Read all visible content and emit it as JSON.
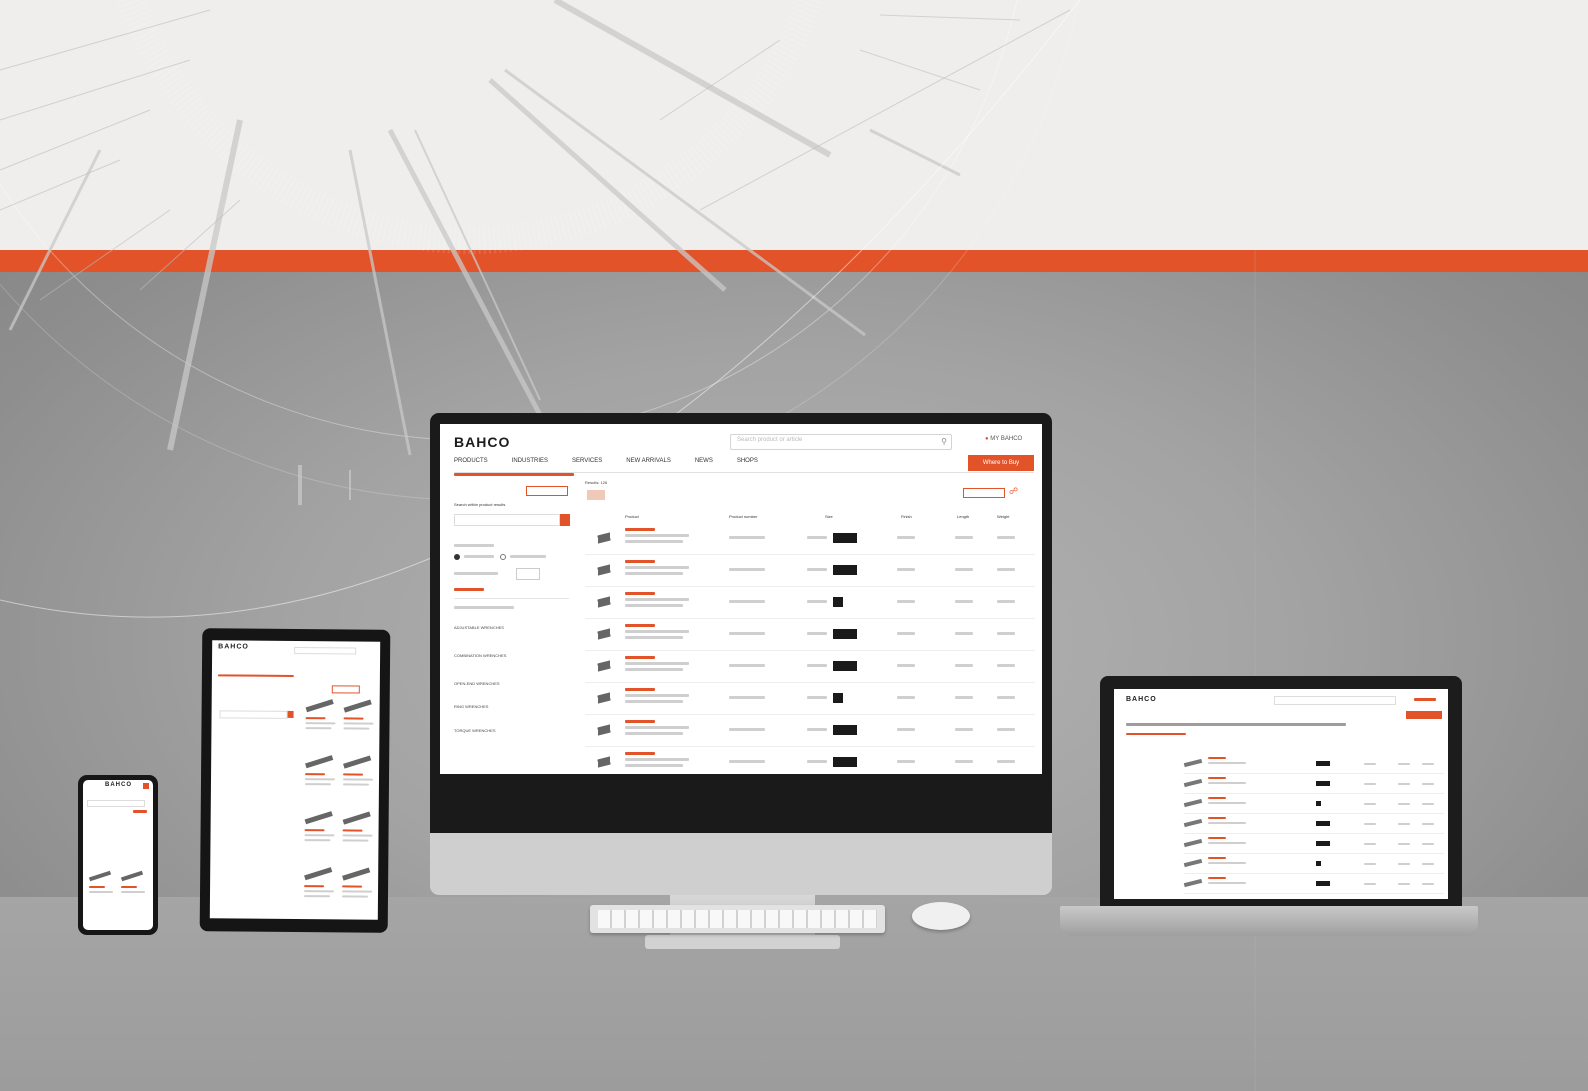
{
  "brand": {
    "logo": "BAHCO",
    "accent_color": "#e2532a"
  },
  "monitor": {
    "nav": [
      "PRODUCTS",
      "INDUSTRIES",
      "SERVICES",
      "NEW ARRIVALS",
      "NEWS",
      "SHOPS"
    ],
    "search_placeholder": "Search product or article",
    "account_label": "MY BAHCO",
    "primary_button": "Where to Buy",
    "filter_heading": "Search within product results",
    "result_count": "Results: 126",
    "columns": [
      "Product",
      "Product number",
      "Size",
      "Finish",
      "Length",
      "Weight"
    ],
    "sections": [
      "ADJUSTABLE WRENCHES",
      "COMBINATION WRENCHES",
      "OPEN-END WRENCHES",
      "RING WRENCHES",
      "TORQUE WRENCHES"
    ]
  },
  "laptop": {
    "logo": "BAHCO"
  },
  "tablet": {
    "logo": "BAHCO"
  },
  "phone": {
    "logo": "BAHCO"
  },
  "icons": {
    "search": "search-icon",
    "user": "user-icon",
    "cart": "cart-icon",
    "chevron": "chevron-down-icon"
  }
}
